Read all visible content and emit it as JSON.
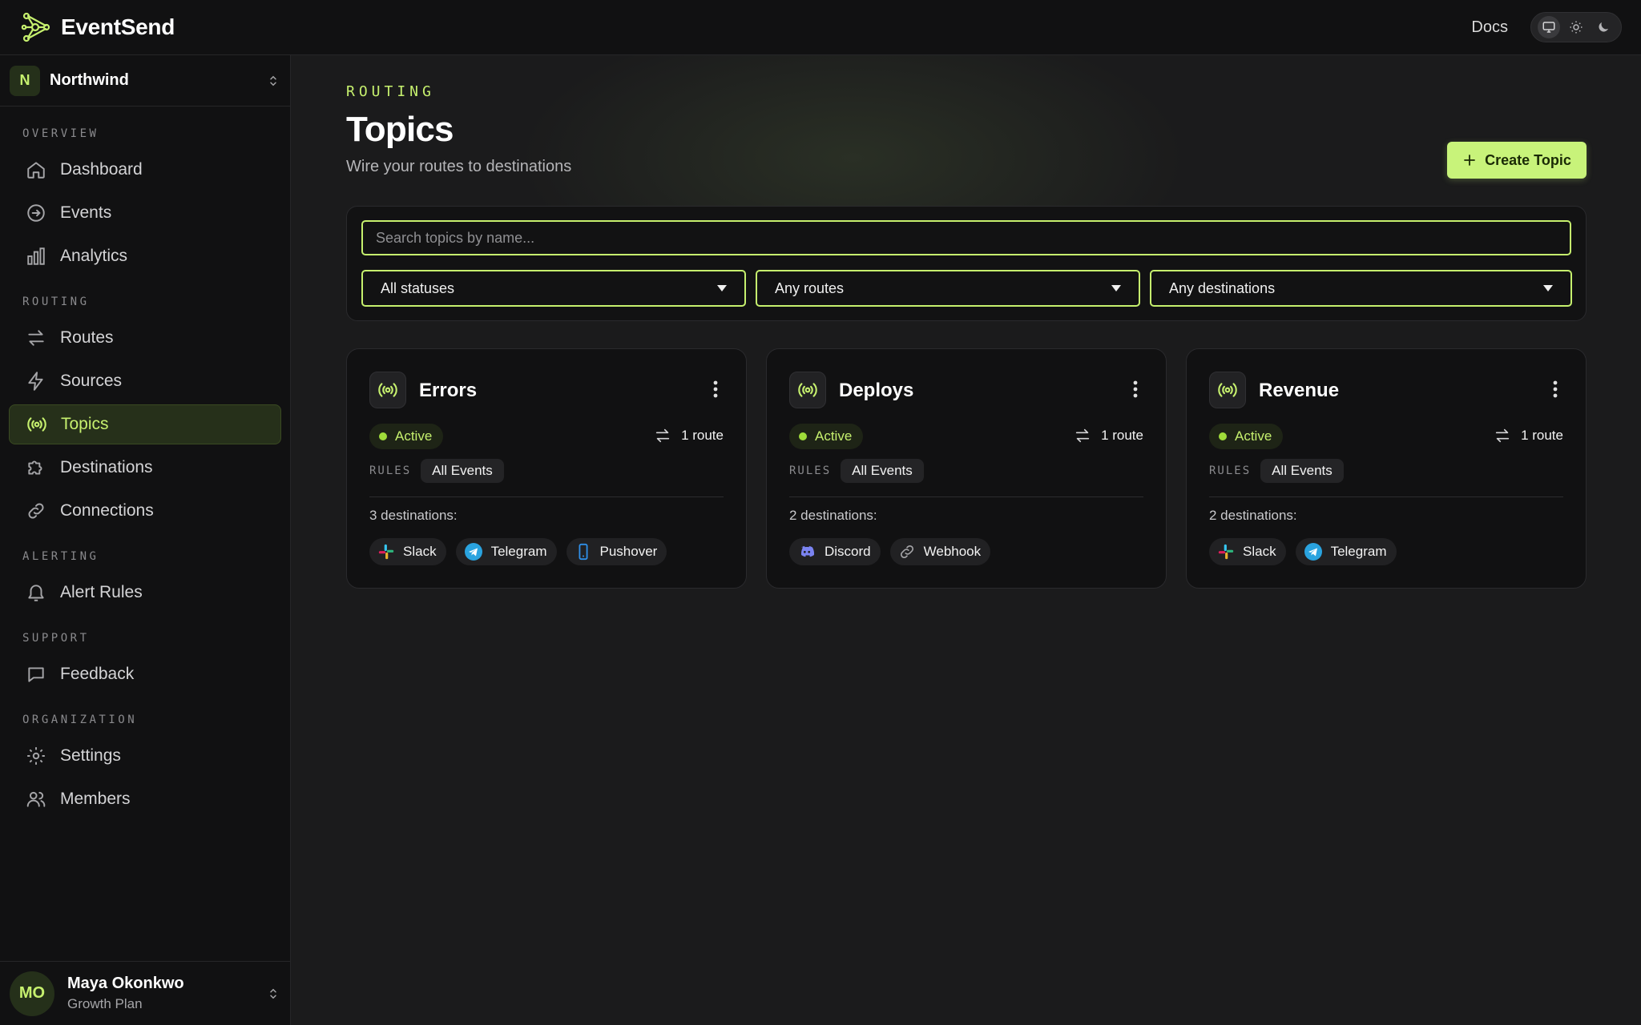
{
  "app": {
    "brand": "EventSend"
  },
  "topbar": {
    "docs_label": "Docs"
  },
  "org": {
    "initial": "N",
    "name": "Northwind"
  },
  "nav": {
    "sections": [
      {
        "heading": "OVERVIEW",
        "items": [
          "Dashboard",
          "Events",
          "Analytics"
        ]
      },
      {
        "heading": "ROUTING",
        "items": [
          "Routes",
          "Sources",
          "Topics",
          "Destinations",
          "Connections"
        ]
      },
      {
        "heading": "ALERTING",
        "items": [
          "Alert Rules"
        ]
      },
      {
        "heading": "SUPPORT",
        "items": [
          "Feedback"
        ]
      },
      {
        "heading": "ORGANIZATION",
        "items": [
          "Settings",
          "Members"
        ]
      }
    ],
    "active": "Topics"
  },
  "user": {
    "initials": "MO",
    "name": "Maya Okonkwo",
    "plan": "Growth Plan"
  },
  "page": {
    "eyebrow": "ROUTING",
    "title": "Topics",
    "subtitle": "Wire your routes to destinations",
    "create_label": "Create Topic"
  },
  "filters": {
    "search_placeholder": "Search topics by name...",
    "status": "All statuses",
    "routes": "Any routes",
    "destinations": "Any destinations"
  },
  "cards": [
    {
      "title": "Errors",
      "status": "Active",
      "routes": "1 route",
      "rules_label": "RULES",
      "rule": "All Events",
      "dest_count": "3 destinations:",
      "destinations": [
        "Slack",
        "Telegram",
        "Pushover"
      ]
    },
    {
      "title": "Deploys",
      "status": "Active",
      "routes": "1 route",
      "rules_label": "RULES",
      "rule": "All Events",
      "dest_count": "2 destinations:",
      "destinations": [
        "Discord",
        "Webhook"
      ]
    },
    {
      "title": "Revenue",
      "status": "Active",
      "routes": "1 route",
      "rules_label": "RULES",
      "rule": "All Events",
      "dest_count": "2 destinations:",
      "destinations": [
        "Slack",
        "Telegram"
      ]
    }
  ],
  "colors": {
    "accent": "#c6f06e",
    "button_bg": "#c8f37a",
    "status_active": "#9fdc3a",
    "background": "#1b1b1c",
    "sidebar": "#111112"
  }
}
